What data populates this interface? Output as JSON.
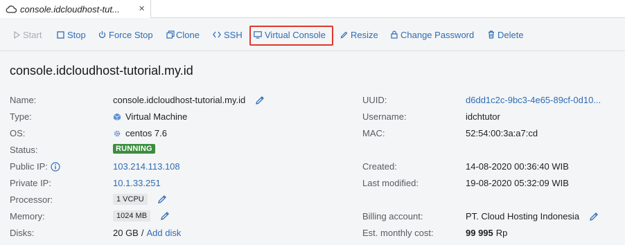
{
  "tab": {
    "label": "console.idcloudhost-tut...",
    "close": "×"
  },
  "toolbar": {
    "start": "Start",
    "stop": "Stop",
    "force_stop": "Force Stop",
    "clone": "Clone",
    "ssh": "SSH",
    "virtual_console": "Virtual Console",
    "resize": "Resize",
    "change_password": "Change Password",
    "delete": "Delete"
  },
  "page": {
    "title": "console.idcloudhost-tutorial.my.id"
  },
  "left": {
    "name_label": "Name:",
    "name": "console.idcloudhost-tutorial.my.id",
    "type_label": "Type:",
    "type": "Virtual Machine",
    "os_label": "OS:",
    "os": "centos 7.6",
    "status_label": "Status:",
    "status": "RUNNING",
    "public_ip_label": "Public IP:",
    "public_ip": "103.214.113.108",
    "private_ip_label": "Private IP:",
    "private_ip": "10.1.33.251",
    "processor_label": "Processor:",
    "processor": "1 VCPU",
    "memory_label": "Memory:",
    "memory": "1024 MB",
    "disks_label": "Disks:",
    "disks": "20 GB",
    "disks_sep": "/",
    "add_disk": "Add disk"
  },
  "right": {
    "uuid_label": "UUID:",
    "uuid": "d6dd1c2c-9bc3-4e65-89cf-0d10...",
    "username_label": "Username:",
    "username": "idchtutor",
    "mac_label": "MAC:",
    "mac": "52:54:00:3a:a7:cd",
    "created_label": "Created:",
    "created": "14-08-2020 00:36:40 WIB",
    "modified_label": "Last modified:",
    "modified": "19-08-2020 05:32:09 WIB",
    "billing_label": "Billing account:",
    "billing": "PT. Cloud Hosting Indonesia",
    "cost_label": "Est. monthly cost:",
    "cost": "99 995",
    "cost_unit": "Rp"
  },
  "colors": {
    "link": "#2d6cb5",
    "running": "#3c8d3f",
    "highlight": "#e0362b"
  },
  "icons": [
    "cloud-icon",
    "close-icon",
    "play-icon",
    "stop-icon",
    "power-icon",
    "clone-icon",
    "code-icon",
    "monitor-icon",
    "pencil-icon",
    "lock-icon",
    "trash-icon",
    "cube-icon",
    "gear-icon",
    "info-icon"
  ]
}
